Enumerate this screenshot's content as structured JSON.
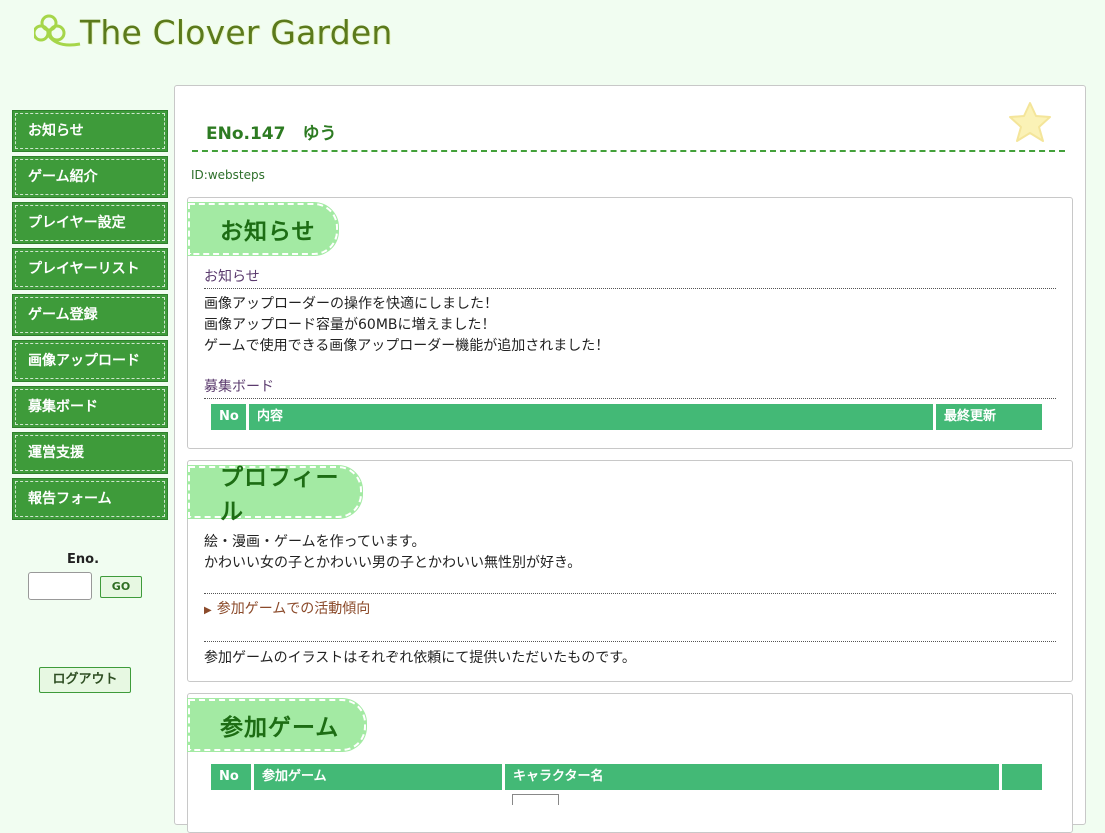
{
  "site": {
    "title": "The Clover Garden"
  },
  "nav": {
    "items": [
      {
        "label": "お知らせ"
      },
      {
        "label": "ゲーム紹介"
      },
      {
        "label": "プレイヤー設定"
      },
      {
        "label": "プレイヤーリスト"
      },
      {
        "label": "ゲーム登録"
      },
      {
        "label": "画像アップロード"
      },
      {
        "label": "募集ボード"
      },
      {
        "label": "運営支援"
      },
      {
        "label": "報告フォーム"
      }
    ],
    "eno_label": "Eno.",
    "eno_value": "",
    "go_label": "GO",
    "logout_label": "ログアウト"
  },
  "character": {
    "title": "ENo.147　ゆう",
    "id_line": "ID:websteps"
  },
  "notice_panel": {
    "heading": "お知らせ",
    "sub_heading": "お知らせ",
    "lines": [
      "画像アップローダーの操作を快適にしました！",
      "画像アップロード容量が60MBに増えました！",
      "ゲームで使用できる画像アップローダー機能が追加されました！"
    ],
    "board_heading": "募集ボード",
    "board_columns": [
      "No",
      "内容",
      "最終更新"
    ]
  },
  "profile_panel": {
    "heading": "プロフィール",
    "lines": [
      "絵・漫画・ゲームを作っています。",
      "かわいい女の子とかわいい男の子とかわいい無性別が好き。"
    ],
    "toggle_label": "参加ゲームでの活動傾向",
    "footer_line": "参加ゲームのイラストはそれぞれ依頼にて提供いただいたものです。"
  },
  "games_panel": {
    "heading": "参加ゲーム",
    "columns": [
      "No",
      "参加ゲーム",
      "キャラクター名",
      ""
    ]
  },
  "colors": {
    "nav_bg": "#3e9b3a",
    "table_header": "#43b976",
    "tab_bg": "#a3eaa3",
    "page_bg": "#f1fdf1",
    "title_green": "#2d7b22"
  }
}
